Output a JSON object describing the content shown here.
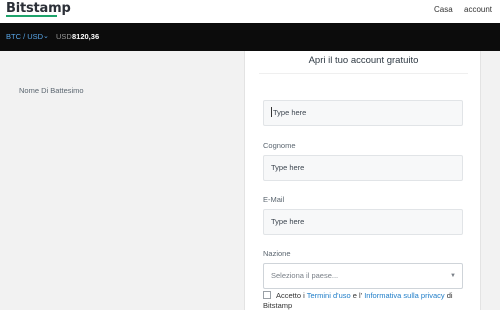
{
  "header": {
    "logo": "Bitstamp",
    "nav": {
      "home": "Casa",
      "account": "account"
    }
  },
  "ticker": {
    "pair": "BTC / USD",
    "pair_chevron_icon": "chevron-down-icon",
    "currency": "USD",
    "price": "8120,36"
  },
  "form": {
    "title": "Apri il tuo account gratuito",
    "first_name": {
      "label": "Nome Di Battesimo",
      "placeholder": "Type here"
    },
    "last_name": {
      "label": "Cognome",
      "placeholder": "Type here"
    },
    "email": {
      "label": "E-Mail",
      "placeholder": "Type here"
    },
    "country": {
      "label": "Nazione",
      "selected": "Seleziona il paese...",
      "caret_icon": "caret-down-icon"
    },
    "terms": {
      "prefix": "Accetto i",
      "terms_link": "Termini d'uso",
      "middle": "e l'",
      "privacy_link": "Informativa sulla privacy",
      "suffix": "di Bitstamp"
    }
  },
  "colors": {
    "accent_link": "#1e7dc8",
    "ticker_bg": "#0c0c0c",
    "logo_underline": "#1ea36b"
  }
}
